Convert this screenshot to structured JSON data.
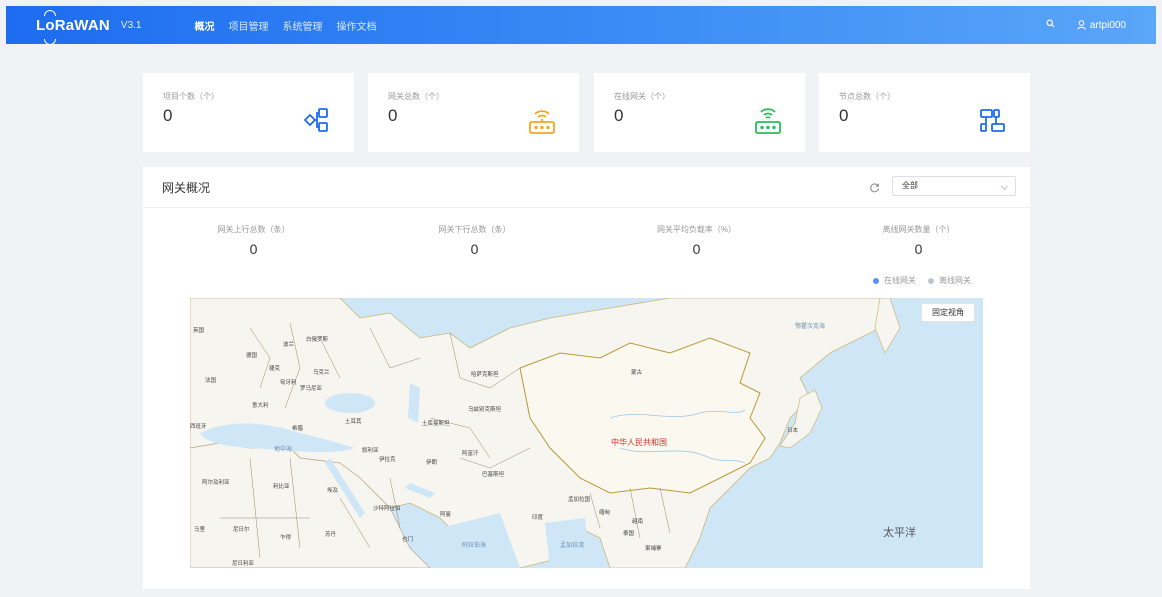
{
  "header": {
    "logo": "LoRaWAN",
    "version": "V3.1",
    "nav": [
      "概况",
      "项目管理",
      "系统管理",
      "操作文档"
    ],
    "username": "artpi000"
  },
  "cards": [
    {
      "label": "项目个数（个）",
      "value": "0",
      "icon": "project-nodes-icon",
      "color": "#1e6cf0"
    },
    {
      "label": "网关总数（个）",
      "value": "0",
      "icon": "gateway-router-icon",
      "color": "#f5a623"
    },
    {
      "label": "在线网关（个）",
      "value": "0",
      "icon": "online-gateway-icon",
      "color": "#2ebc5a"
    },
    {
      "label": "节点总数（个）",
      "value": "0",
      "icon": "node-network-icon",
      "color": "#1e6cf0"
    }
  ],
  "overview": {
    "title": "网关概况",
    "filter_value": "全部",
    "metrics": [
      {
        "label": "网关上行总数（条）",
        "value": "0"
      },
      {
        "label": "网关下行总数（条）",
        "value": "0"
      },
      {
        "label": "网关平均负载率（%）",
        "value": "0"
      },
      {
        "label": "离线网关数量（个）",
        "value": "0"
      }
    ],
    "legend": [
      {
        "label": "在线网关",
        "color": "#5b8ff9"
      },
      {
        "label": "离线网关",
        "color": "#c0c4cc"
      }
    ],
    "map": {
      "fixed_view_button": "固定视角",
      "labels": {
        "china": "中华人民共和国",
        "pacific": "太平洋",
        "england": "英国",
        "germany": "德国",
        "france": "法国",
        "poland": "波兰",
        "ukraine": "乌克兰",
        "belarus": "白俄罗斯",
        "kazakhstan": "哈萨克斯坦",
        "mongolia": "蒙古",
        "turkey": "土耳其",
        "turkmenistan": "土库曼斯坦",
        "iran": "伊朗",
        "iraq": "伊拉克",
        "afghanistan": "阿富汗",
        "pakistan": "巴基斯坦",
        "india": "印度",
        "egypt": "埃及",
        "libya": "利比亚",
        "algeria": "阿尔及利亚",
        "saudi": "沙特阿拉伯",
        "italy": "意大利",
        "greece": "希腊",
        "mediterranean": "地中海",
        "japan": "日本",
        "okhotsk": "鄂霍次克海",
        "arabian_sea": "阿拉伯海",
        "bay_of_bengal": "孟加拉湾",
        "thailand": "泰国",
        "sudan": "苏丹",
        "niger": "尼日尔",
        "chad": "乍得",
        "mali": "马里",
        "yemen": "也门",
        "oman": "阿曼",
        "myanmar": "缅甸",
        "spain": "西班牙",
        "czech": "捷克",
        "hungary": "匈牙利",
        "romania": "罗马尼亚",
        "uzbekistan": "乌兹别克斯坦",
        "syria": "叙利亚",
        "vietnam": "越南",
        "bangladesh": "孟加拉国",
        "cambodia": "柬埔寨",
        "nigeria": "尼日利亚"
      }
    }
  }
}
